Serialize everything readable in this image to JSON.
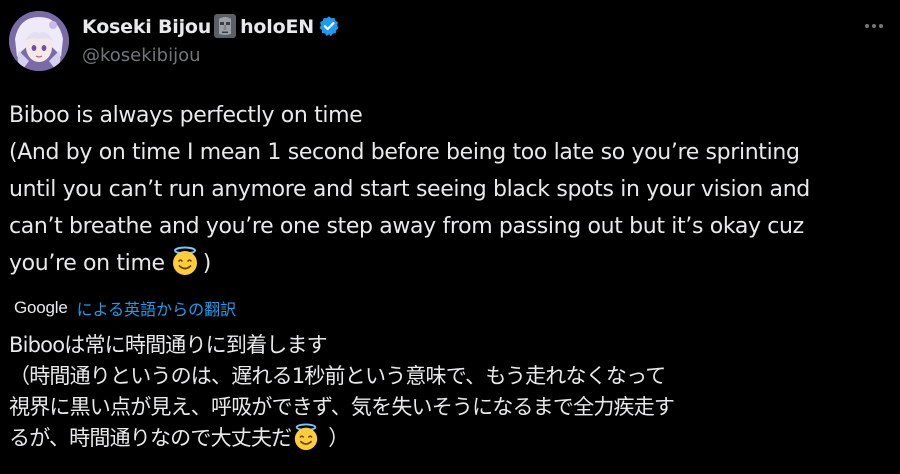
{
  "author": {
    "display_name_part1": "Koseki Bijou",
    "display_name_part2": "holoEN",
    "handle": "@kosekibijou",
    "icons": [
      "moai-emoji-icon",
      "verified-badge-icon"
    ],
    "verified_color": "#1d9bf0"
  },
  "header": {
    "more_icon": "more-options-icon"
  },
  "tweet": {
    "lines": [
      "Biboo is always perfectly on time",
      "(And by on time I mean 1 second before being too late so you’re sprinting",
      "until you can’t run anymore and start seeing black spots in your vision and",
      "can’t breathe and you’re one step away from passing out but it’s okay cuz",
      "you’re on time"
    ],
    "closing": ")",
    "emoji": "smiling-face-with-halo-icon"
  },
  "translation": {
    "provider": "Google",
    "link_text": "による英語からの翻訳",
    "lines": [
      "Bibooは常に時間通りに到着します",
      "（時間通りというのは、遅れる1秒前という意味で、もう走れなくなって",
      "視界に黒い点が見え、呼吸ができず、気を失いそうになるまで全力疾走す",
      "るが、時間通りなので大丈夫だ"
    ],
    "closing": " ）"
  },
  "colors": {
    "background": "#000000",
    "text": "#e7e9ea",
    "secondary": "#71767b",
    "link": "#1d9bf0"
  }
}
